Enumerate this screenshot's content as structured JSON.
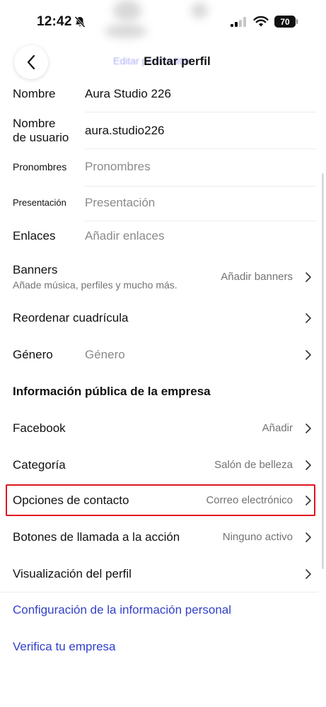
{
  "status_bar": {
    "time": "12:42",
    "battery": "70"
  },
  "header": {
    "title": "Editar perfil",
    "ghost_text": "Editar perfil editar"
  },
  "fields": [
    {
      "label": "Nombre",
      "value": "Aura Studio 226"
    },
    {
      "label": "Nombre de usuario",
      "value": "aura.studio226"
    },
    {
      "label": "Pronombres",
      "placeholder": "Pronombres"
    },
    {
      "label": "Presentación",
      "placeholder": "Presentación"
    },
    {
      "label": "Enlaces",
      "placeholder": "Añadir enlaces"
    }
  ],
  "banners": {
    "label": "Banners",
    "sub": "Añade música, perfiles y mucho más.",
    "action": "Añadir banners"
  },
  "reorder": {
    "label": "Reordenar cuadrícula"
  },
  "gender": {
    "label": "Género",
    "placeholder": "Género"
  },
  "business": {
    "section_title": "Información pública de la empresa",
    "items": [
      {
        "label": "Facebook",
        "value": "Añadir"
      },
      {
        "label": "Categoría",
        "value": "Salón de belleza"
      },
      {
        "label": "Opciones de contacto",
        "value": "Correo electrónico"
      },
      {
        "label": "Botones de llamada a la acción",
        "value": "Ninguno activo"
      },
      {
        "label": "Visualización del perfil",
        "value": ""
      }
    ]
  },
  "links": {
    "personal_info": "Configuración de la información personal",
    "verify": "Verifica tu empresa"
  },
  "colors": {
    "link": "#3340c9",
    "highlight": "#e0141e"
  }
}
